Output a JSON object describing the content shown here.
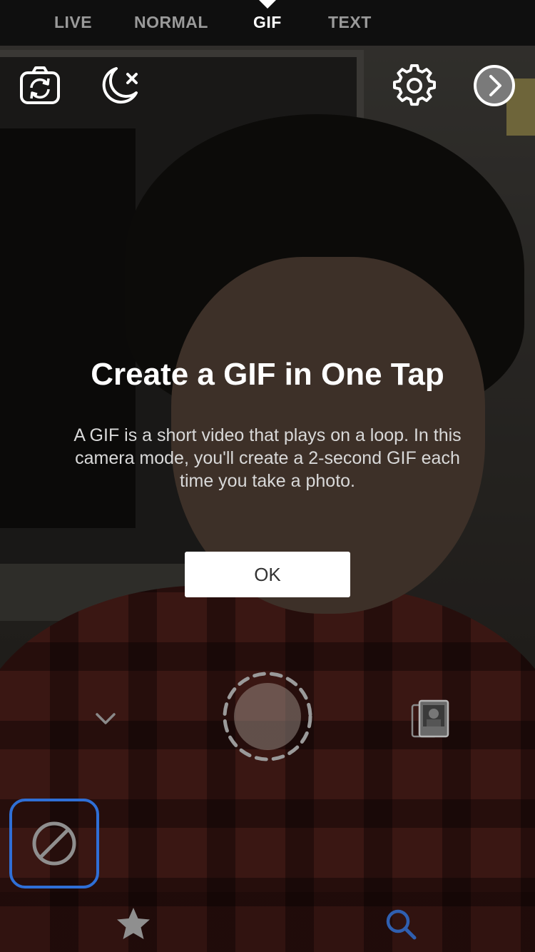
{
  "mode_bar": {
    "tabs": [
      {
        "label": "LIVE",
        "active": false
      },
      {
        "label": "NORMAL",
        "active": false
      },
      {
        "label": "GIF",
        "active": true
      },
      {
        "label": "TEXT",
        "active": false
      }
    ]
  },
  "top_controls": {
    "icons": [
      "camera-flip-icon",
      "night-mode-off-icon",
      "gear-icon",
      "chevron-right-circle-icon"
    ]
  },
  "tutorial": {
    "title": "Create a GIF in One Tap",
    "body": "A GIF is a short video that plays on a loop. In this camera mode, you'll create a 2-second GIF each time you take a photo.",
    "ok_label": "OK"
  },
  "capture_controls": {
    "icons": [
      "chevron-down-icon",
      "shutter-button",
      "gallery-icon"
    ]
  },
  "effects_bar": {
    "selected_effect": "none",
    "icons": [
      "no-effect-icon",
      "star-icon",
      "search-icon"
    ]
  },
  "colors": {
    "mode_bar_bg": "#0f0f0f",
    "active_tab": "#ffffff",
    "inactive_tab": "#9a9a9a",
    "selection_border": "#2f6fd6",
    "search_icon": "#2f5fb0"
  }
}
